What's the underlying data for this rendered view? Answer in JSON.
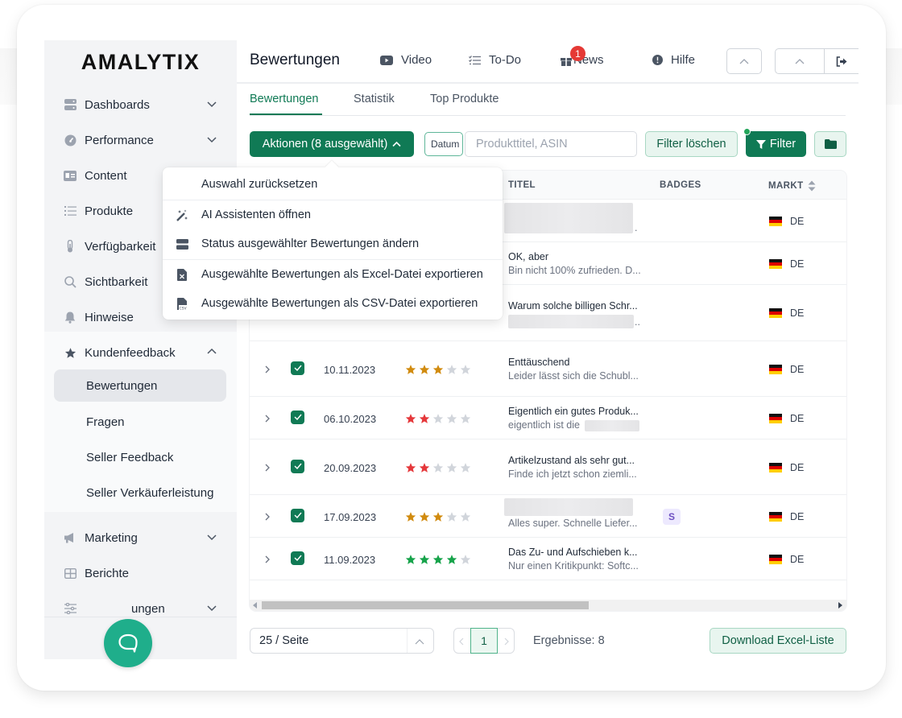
{
  "app": {
    "logo": "AMALYTIX",
    "brand_color": "#107a55"
  },
  "sidebar": {
    "items": [
      {
        "label": "Dashboards",
        "icon": "server-icon",
        "expandable": true,
        "expanded": false
      },
      {
        "label": "Performance",
        "icon": "gauge-icon",
        "expandable": true,
        "expanded": false
      },
      {
        "label": "Content",
        "icon": "id-card-icon",
        "expandable": false
      },
      {
        "label": "Produkte",
        "icon": "list-icon",
        "expandable": false
      },
      {
        "label": "Verfügbarkeit",
        "icon": "thermometer-icon",
        "expandable": false
      },
      {
        "label": "Sichtbarkeit",
        "icon": "search-icon",
        "expandable": false
      },
      {
        "label": "Hinweise",
        "icon": "bell-icon",
        "expandable": false
      },
      {
        "label": "Kundenfeedback",
        "icon": "star-icon",
        "expandable": true,
        "expanded": true
      },
      {
        "label": "Marketing",
        "icon": "megaphone-icon",
        "expandable": true,
        "expanded": false
      },
      {
        "label": "Berichte",
        "icon": "table-icon",
        "expandable": false
      },
      {
        "label": "Einstellungen",
        "visible_label": "ungen",
        "icon": "sliders-icon",
        "expandable": true,
        "expanded": false
      }
    ],
    "subitems": [
      {
        "label": "Bewertungen",
        "active": true
      },
      {
        "label": "Fragen",
        "active": false
      },
      {
        "label": "Seller Feedback",
        "active": false
      },
      {
        "label": "Seller Verkäuferleistung",
        "active": false
      }
    ],
    "collapse_icon": "double-chevron-left-icon"
  },
  "header": {
    "title": "Bewertungen",
    "links": [
      {
        "label": "Video",
        "icon": "youtube-icon"
      },
      {
        "label": "To-Do",
        "icon": "checklist-icon"
      },
      {
        "label": "News",
        "icon": "gift-icon",
        "badge": "1"
      },
      {
        "label": "Hilfe",
        "icon": "info-circle-icon"
      }
    ]
  },
  "tabs": [
    {
      "label": "Bewertungen",
      "active": true
    },
    {
      "label": "Statistik",
      "active": false
    },
    {
      "label": "Top Produkte",
      "active": false
    }
  ],
  "toolbar": {
    "actions_label": "Aktionen (8 ausgewählt)",
    "date_label": "Datum",
    "search_placeholder": "Produkttitel, ASIN",
    "search_value": "",
    "clear_filter_label": "Filter löschen",
    "filter_label": "Filter",
    "filter_active": true
  },
  "actions_menu": {
    "items": [
      {
        "label": "Auswahl zurücksetzen",
        "icon": ""
      },
      {
        "label": "AI Assistenten öffnen",
        "icon": "magic-wand-icon"
      },
      {
        "label": "Status ausgewählter Bewertungen ändern",
        "icon": "server-icon"
      },
      {
        "label": "Ausgewählte Bewertungen als Excel-Datei exportieren",
        "icon": "excel-file-icon"
      },
      {
        "label": "Ausgewählte Bewertungen als CSV-Datei exportieren",
        "icon": "csv-file-icon"
      }
    ]
  },
  "table": {
    "columns": [
      "TITEL",
      "BADGES",
      "MARKT"
    ],
    "rows": [
      {
        "date": "",
        "rating": null,
        "title": "",
        "text": ".",
        "title_redacted": true,
        "badge": "",
        "market": "DE",
        "checked": true
      },
      {
        "date": "",
        "rating": null,
        "title": "OK, aber",
        "text": "Bin nicht 100% zufrieden. D...",
        "badge": "",
        "market": "DE",
        "checked": true
      },
      {
        "date": "",
        "rating": null,
        "title": "Warum solche billigen Schr...",
        "text": "..",
        "text_redacted": true,
        "badge": "",
        "market": "DE",
        "checked": true
      },
      {
        "date": "10.11.2023",
        "rating": 3,
        "title": "Enttäuschend",
        "text": "Leider lässt sich die Schubl...",
        "badge": "",
        "market": "DE",
        "checked": true
      },
      {
        "date": "06.10.2023",
        "rating": 2,
        "title": "Eigentlich ein gutes Produk...",
        "text": "eigentlich ist die",
        "text_redacted": true,
        "badge": "",
        "market": "DE",
        "checked": true
      },
      {
        "date": "20.09.2023",
        "rating": 2,
        "title": "Artikelzustand als sehr gut...",
        "text": "Finde ich jetzt schon ziemli...",
        "badge": "",
        "market": "DE",
        "checked": true
      },
      {
        "date": "17.09.2023",
        "rating": 3,
        "title": "",
        "title_redacted": true,
        "text": "Alles super. Schnelle Liefer...",
        "badge": "S",
        "market": "DE",
        "checked": true
      },
      {
        "date": "11.09.2023",
        "rating": 4,
        "title": "Das Zu- und Aufschieben k...",
        "text": "Nur einen Kritikpunkt: Softc...",
        "badge": "",
        "market": "DE",
        "checked": true
      }
    ],
    "star_colors": {
      "2": "#e5383b",
      "3": "#d18b0f",
      "4": "#16a34a",
      "empty": "#d1d5db"
    }
  },
  "footer": {
    "page_size": "25 / Seite",
    "current_page": "1",
    "results_label": "Ergebnisse: 8",
    "download_label": "Download Excel-Liste"
  }
}
